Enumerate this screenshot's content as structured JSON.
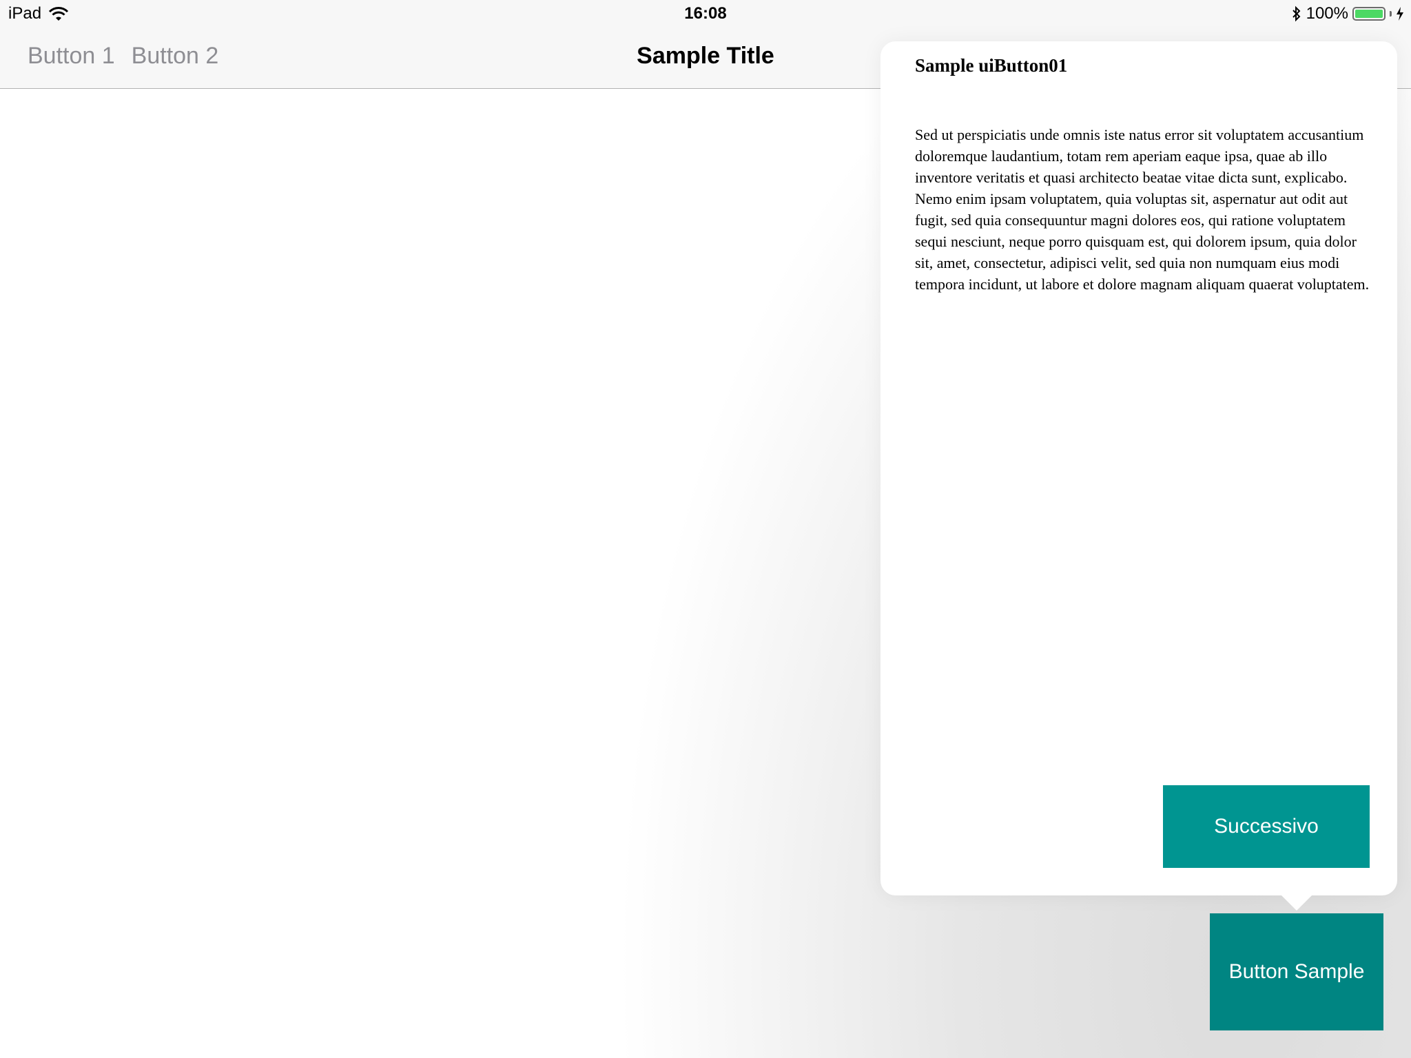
{
  "status_bar": {
    "device": "iPad",
    "time": "16:08",
    "battery_percent": "100%",
    "battery_level": 1.0,
    "wifi_icon": "wifi-icon",
    "bluetooth_icon": "bluetooth-icon",
    "charging_icon": "charging-bolt-icon"
  },
  "nav_bar": {
    "buttons": [
      "Button 1",
      "Button 2"
    ],
    "title": "Sample Title"
  },
  "popover": {
    "title": "Sample uiButton01",
    "body": "Sed ut perspiciatis unde omnis iste natus error sit voluptatem accusantium doloremque laudantium, totam rem aperiam eaque ipsa, quae ab illo inventore veritatis et quasi architecto beatae vitae dicta sunt, explicabo. Nemo enim ipsam voluptatem, quia voluptas sit, aspernatur aut odit aut fugit, sed quia consequuntur magni dolores eos, qui ratione voluptatem sequi nesciunt, neque porro quisquam est, qui dolorem ipsum, quia dolor sit, amet, consectetur, adipisci velit, sed quia non numquam eius modi tempora incidunt, ut labore et dolore magnam aliquam quaerat voluptatem.",
    "next_label": "Successivo"
  },
  "main": {
    "sample_button_label": "Button Sample"
  },
  "colors": {
    "accent_teal": "#009591",
    "sample_button_teal": "#008582",
    "battery_green": "#4cd964",
    "nav_button_gray": "#8e8e93"
  }
}
